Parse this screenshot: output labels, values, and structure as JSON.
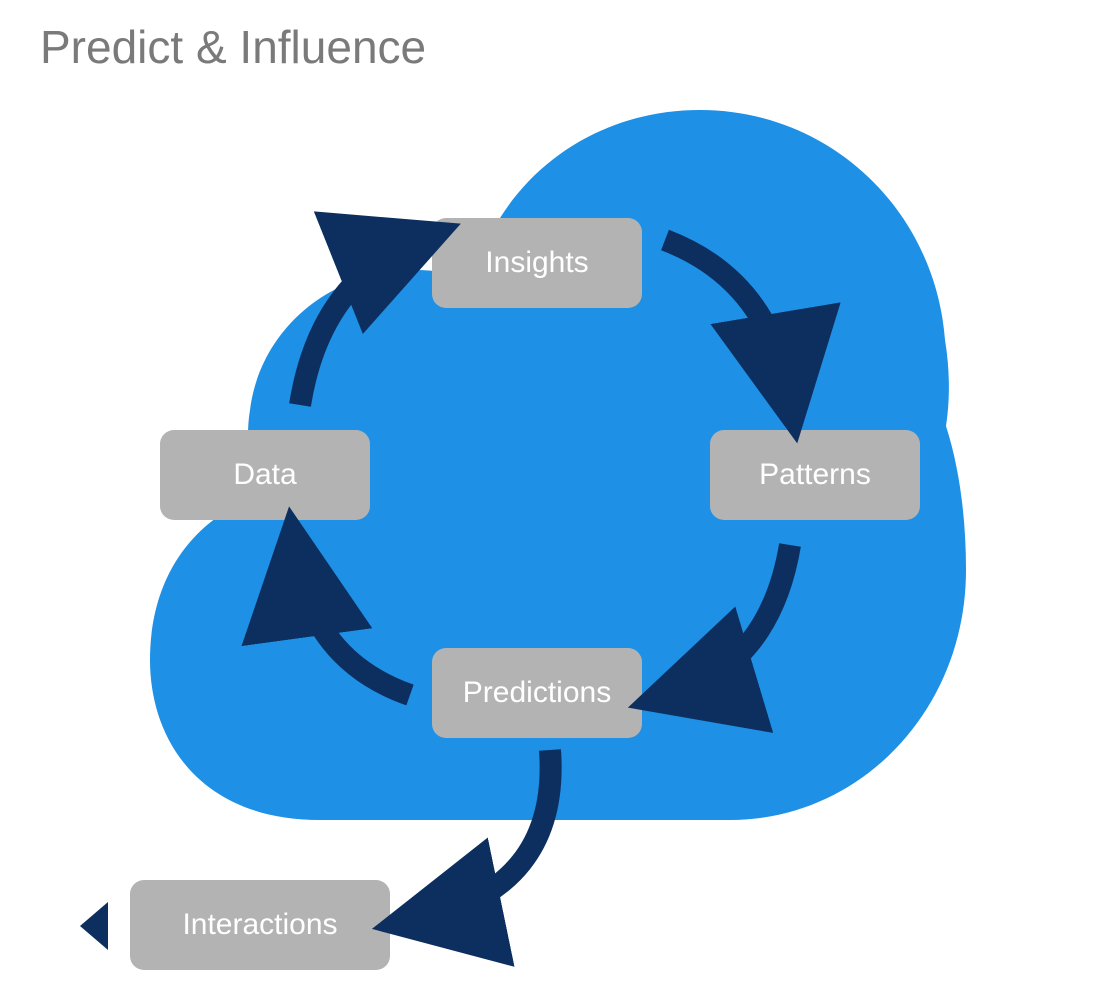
{
  "title": "Predict & Influence",
  "nodes": {
    "insights": "Insights",
    "patterns": "Patterns",
    "predictions": "Predictions",
    "data": "Data",
    "interactions": "Interactions"
  },
  "colors": {
    "cloud": "#1e90e6",
    "node": "#b3b3b3",
    "arrow": "#0d2f5f",
    "title": "#7a7a7a",
    "node_text": "#ffffff"
  },
  "flow": {
    "cycle": [
      "Data",
      "Insights",
      "Patterns",
      "Predictions"
    ],
    "branch_from": "Predictions",
    "branch_to": "Interactions"
  }
}
